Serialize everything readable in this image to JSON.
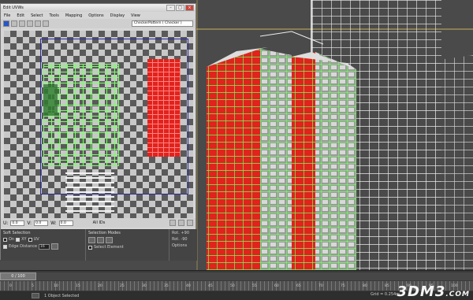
{
  "window": {
    "title": "Edit UVWs"
  },
  "menu": [
    "File",
    "Edit",
    "Select",
    "Tools",
    "Mapping",
    "Options",
    "Display",
    "View"
  ],
  "toolbar": {
    "texture_select": "CheckerPattern  ( Checker )"
  },
  "uv_bottom": {
    "u_value": "0.0",
    "v_value": "0.0",
    "w_value": "0.0",
    "ids_label": "All IDs"
  },
  "panels": {
    "soft_selection": {
      "title": "Soft Selection",
      "on_label": "On",
      "xy_label": "XY",
      "uv_label": "UV",
      "edge_distance_label": "Edge Distance",
      "edge_distance_value": "16"
    },
    "selection_modes": {
      "title": "Selection Modes",
      "select_element_label": "Select Element"
    },
    "rot": {
      "rot_plus": "Rot. +90",
      "rot_minus": "Rot. -90",
      "options": "Options"
    }
  },
  "timeline": {
    "frame": "0 / 100",
    "ticks": [
      "0",
      "5",
      "10",
      "15",
      "20",
      "25",
      "30",
      "35",
      "40",
      "45",
      "50",
      "55",
      "60",
      "65",
      "70",
      "75",
      "80",
      "85",
      "90",
      "95",
      "100"
    ]
  },
  "status": {
    "selected": "1 Object Selected",
    "grid": "Grid = 0.254m"
  },
  "watermark": {
    "brand": "3DM3",
    "suffix": ".COM"
  },
  "colors": {
    "uv_red": "#e0231c",
    "uv_green": "#7cff6a",
    "frame_blue": "#2a2aa0"
  }
}
